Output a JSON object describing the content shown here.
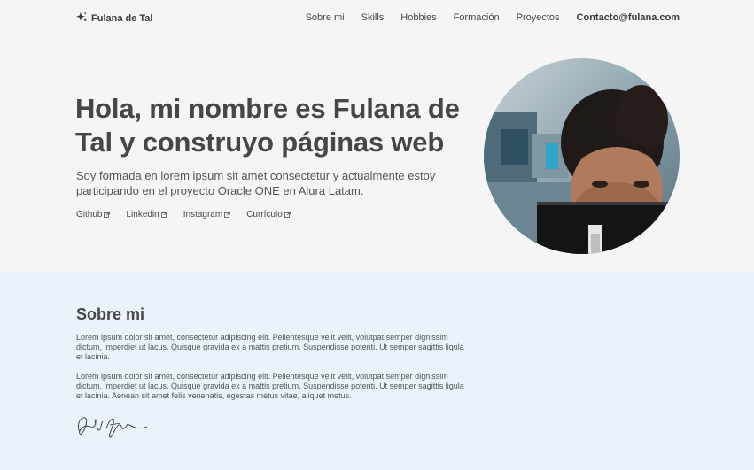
{
  "header": {
    "brand": "Fulana de Tal",
    "nav": [
      "Sobre mi",
      "Skills",
      "Hobbies",
      "Formación",
      "Proyectos"
    ],
    "contact": "Contacto@fulana.com"
  },
  "hero": {
    "title": "Hola, mi nombre es Fulana de Tal y construyo páginas web",
    "subtitle": "Soy formada en lorem ipsum sit amet consectetur y actualmente estoy participando en el proyecto Oracle ONE en Alura Latam.",
    "links": [
      "Github",
      "Linkedin",
      "Instagram",
      "Currículo"
    ],
    "link_icon": "external-link-icon",
    "photo": "profile-photo"
  },
  "about": {
    "title": "Sobre mi",
    "paragraph1": "Lorem ipsum dolor sit amet, consectetur adipiscing elit. Pellentesque velit velit, volutpat semper dignissim dictum, imperdiet ut lacus. Quisque gravida ex a mattis pretium. Suspendisse potenti. Ut semper sagittis ligula et lacinia.",
    "paragraph2": "Lorem ipsum dolor sit amet, consectetur adipiscing elit. Pellentesque velit velit, volutpat semper dignissim dictum, imperdiet ut lacus. Quisque gravida ex a mattis pretium. Suspendisse potenti. Ut semper sagittis ligula et lacinia. Aenean sit amet felis venenatis, egestas metus vitae, aliquet metus.",
    "signature_icon": "signature-icon"
  },
  "colors": {
    "hero_bg": "#f5f5f5",
    "about_bg": "#eaf2fb",
    "text": "#464646"
  }
}
